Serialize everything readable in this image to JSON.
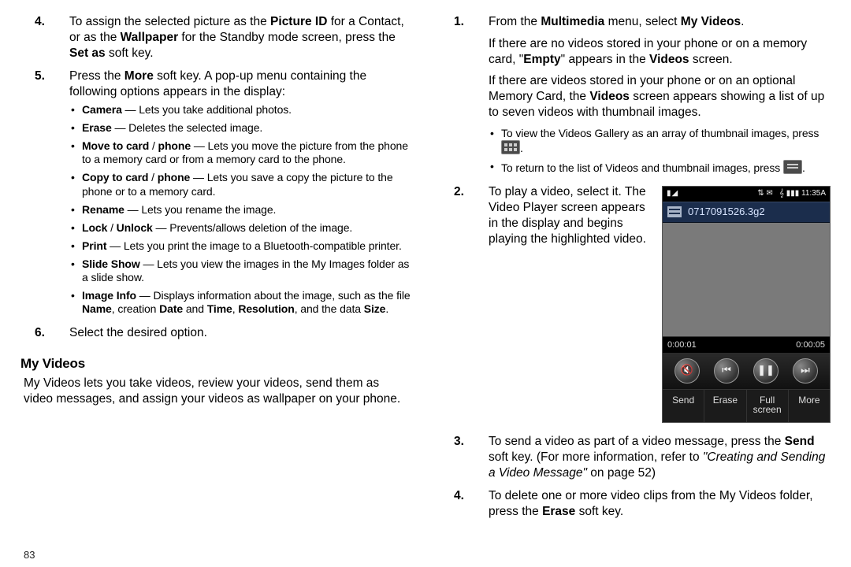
{
  "pageNumber": "83",
  "left": {
    "items": [
      {
        "num": "4.",
        "html": "To assign the selected picture as the <b>Picture ID</b> for a Contact, or as the <b>Wallpaper</b> for the Standby mode screen, press the <b>Set as</b> soft key."
      },
      {
        "num": "5.",
        "html": "Press the <b>More</b> soft key. A pop-up menu containing the following options appears in the display:",
        "bullets": [
          "<b>Camera</b> — Lets you take additional photos.",
          "<b>Erase</b> — Deletes the selected image.",
          "<b>Move to card</b> / <b>phone</b> — Lets you move the picture from the phone to a memory card or from a memory card to the phone.",
          "<b>Copy to card</b> / <b>phone</b> — Lets you save a copy the picture to the phone or to a memory card.",
          "<b>Rename</b> — Lets you rename the image.",
          "<b>Lock</b> / <b>Unlock</b> — Prevents/allows deletion of the image.",
          "<b>Print</b> — Lets you print the image to a Bluetooth-compatible printer.",
          "<b>Slide Show</b> — Lets you view the images in the My Images folder as a slide show.",
          "<b>Image Info</b> — Displays information about the image, such as the file <b>Name</b>, creation <b>Date</b> and <b>Time</b>, <b>Resolution</b>, and the data <b>Size</b>."
        ]
      },
      {
        "num": "6.",
        "html": "Select the desired option."
      }
    ],
    "sectionTitle": "My Videos",
    "sectionIntro": "My Videos lets you take videos, review your videos, send them as video messages, and assign your videos as wallpaper on your phone."
  },
  "right": {
    "items": [
      {
        "num": "1.",
        "paras": [
          "From the <b>Multimedia</b> menu, select <b>My Videos</b>.",
          "If there are no videos stored in your phone or on a memory card, \"<b>Empty</b>\" appears in the <b>Videos</b> screen.",
          "If there are videos stored in your phone or on an optional Memory Card, the <b>Videos</b> screen appears showing a list of up to seven videos with thumbnail images."
        ],
        "bullets": [
          {
            "type": "grid",
            "prefix": "To view the Videos Gallery as an array of thumbnail images, press ",
            "suffix": "."
          },
          {
            "type": "list",
            "prefix": "To return to the list of Videos and thumbnail images, press ",
            "suffix": "."
          }
        ]
      },
      {
        "num": "2.",
        "html": "To play a video, select it. The Video Player screen appears in the display and begins playing the highlighted video."
      },
      {
        "num": "3.",
        "html": "To send a video as part of a video message, press the <b>Send</b> soft key. (For more information, refer to <em>\"Creating and Sending a Video Message\"</em>  on page 52)"
      },
      {
        "num": "4.",
        "html": "To delete one or more video clips from the My Videos folder, press the <b>Erase</b> soft key."
      }
    ]
  },
  "phone": {
    "time": "11:35A",
    "title": "0717091526.3g2",
    "elapsed": "0:00:01",
    "total": "0:00:05",
    "controls": [
      "mute-icon",
      "prev-icon",
      "pause-icon",
      "next-icon"
    ],
    "controlGlyphs": {
      "mute-icon": "🔇",
      "prev-icon": "⏮",
      "pause-icon": "❚❚",
      "next-icon": "⏭"
    },
    "softkeys": [
      "Send",
      "Erase",
      "Full\nscreen",
      "More"
    ]
  }
}
